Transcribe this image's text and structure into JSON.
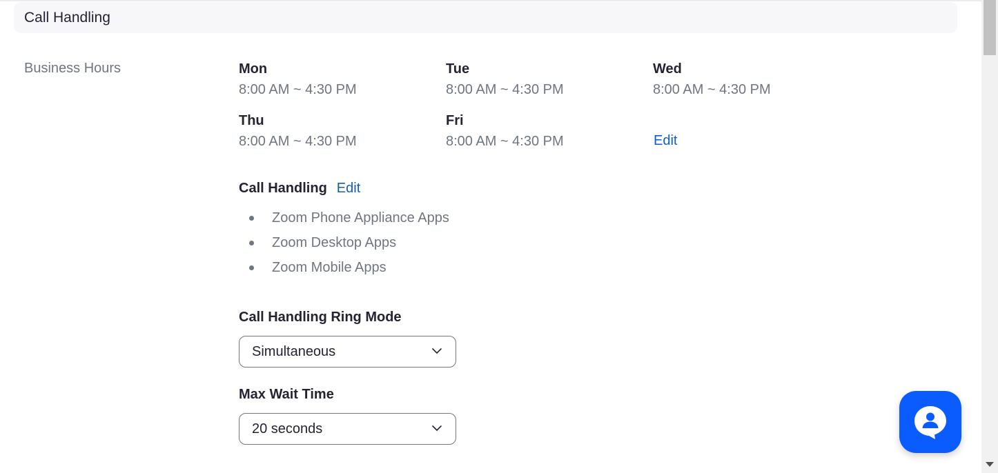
{
  "section": {
    "title": "Call Handling"
  },
  "business_hours": {
    "label": "Business Hours",
    "days": [
      {
        "name": "Mon",
        "hours": "8:00 AM ~ 4:30 PM"
      },
      {
        "name": "Tue",
        "hours": "8:00 AM ~ 4:30 PM"
      },
      {
        "name": "Wed",
        "hours": "8:00 AM ~ 4:30 PM"
      },
      {
        "name": "Thu",
        "hours": "8:00 AM ~ 4:30 PM"
      },
      {
        "name": "Fri",
        "hours": "8:00 AM ~ 4:30 PM"
      }
    ],
    "edit_label": "Edit"
  },
  "call_handling": {
    "title": "Call Handling",
    "edit_label": "Edit",
    "apps": [
      "Zoom Phone Appliance Apps",
      "Zoom Desktop Apps",
      "Zoom Mobile Apps"
    ]
  },
  "ring_mode": {
    "label": "Call Handling Ring Mode",
    "value": "Simultaneous"
  },
  "max_wait": {
    "label": "Max Wait Time",
    "value": "20 seconds"
  },
  "chat_button": {
    "icon": "chat-agent-icon"
  },
  "colors": {
    "accent_link": "#0e5fbd",
    "chat_button": "#0b5cff",
    "muted_text": "#6e7680",
    "primary_text": "#232333"
  }
}
